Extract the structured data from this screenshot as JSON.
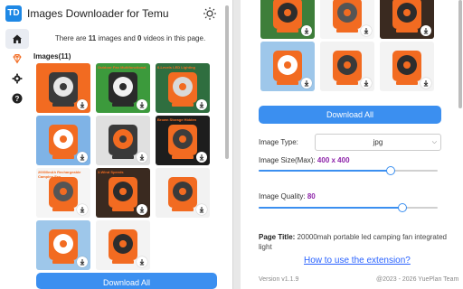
{
  "header": {
    "logo_text": "TD",
    "title": "Images Downloader for Temu"
  },
  "summary": {
    "prefix": "There are ",
    "images": "11",
    "mid": " images and ",
    "videos": "0",
    "suffix": " videos in this page."
  },
  "images_label": "Images(11)",
  "thumbnails": [
    {
      "caption": "",
      "palette": [
        "#f26b21",
        "#3a3a3a",
        "#e7e7e7"
      ]
    },
    {
      "caption": "Outdoor Fan Multifunctional",
      "palette": [
        "#3c9a3c",
        "#2a2a2a",
        "#f1f1f1"
      ]
    },
    {
      "caption": "6-Levels LED Lighting",
      "palette": [
        "#2f6e3f",
        "#f26b21",
        "#d9d9d9"
      ]
    },
    {
      "caption": "",
      "palette": [
        "#7fb3e6",
        "#f26b21",
        "#ffffff"
      ]
    },
    {
      "caption": "",
      "palette": [
        "#e0e0e0",
        "#3a3a3a",
        "#f26b21"
      ]
    },
    {
      "caption": "Brown Storage Hidden",
      "palette": [
        "#1d1d1d",
        "#f26b21",
        "#3d3d3d"
      ]
    },
    {
      "caption": "20000mAh Rechargeable Camping Fan",
      "palette": [
        "#f5f5f5",
        "#f26b21",
        "#555555"
      ]
    },
    {
      "caption": "3-Wind Speeds",
      "palette": [
        "#3a2a20",
        "#f26b21",
        "#2c2c2c"
      ]
    },
    {
      "caption": "",
      "palette": [
        "#f2f2f2",
        "#f26b21",
        "#3a3a3a"
      ]
    },
    {
      "caption": "",
      "palette": [
        "#9ec7ea",
        "#f26b21",
        "#ffffff"
      ]
    },
    {
      "caption": "",
      "palette": [
        "#f3f3f3",
        "#f26b21",
        "#2d2d2d"
      ]
    }
  ],
  "right_thumbnails": [
    {
      "caption": "",
      "palette": [
        "#3e7e3a",
        "#f26b21",
        "#2d2d2d"
      ]
    },
    {
      "caption": "20000mAh Rechargeable Camping Fan",
      "palette": [
        "#f5f5f5",
        "#f26b21",
        "#555555"
      ]
    },
    {
      "caption": "3-Wind Speeds",
      "palette": [
        "#3a2a20",
        "#f26b21",
        "#2c2c2c"
      ]
    },
    {
      "caption": "",
      "palette": [
        "#9ec7ea",
        "#f26b21",
        "#ffffff"
      ]
    },
    {
      "caption": "",
      "palette": [
        "#f2f2f2",
        "#f26b21",
        "#3a3a3a"
      ]
    },
    {
      "caption": "",
      "palette": [
        "#f3f3f3",
        "#f26b21",
        "#2d2d2d"
      ]
    }
  ],
  "buttons": {
    "download_all": "Download All"
  },
  "settings": {
    "image_type_label": "Image Type:",
    "image_type_value": "jpg",
    "image_size_label": "Image Size(Max):",
    "image_size_value": "400 x 400",
    "image_size_level": 0.73,
    "image_quality_label": "Image Quality:",
    "image_quality_value": "80",
    "image_quality_level": 0.8
  },
  "page_title": {
    "label": "Page Title:",
    "value": "20000mah portable led camping fan integrated light"
  },
  "links": {
    "howto": "How to use the extension?"
  },
  "footer": {
    "version": "Version v1.1.9",
    "copyright": "@2023 - 2026 YuePlan Team"
  },
  "colors": {
    "accent": "#3b8ff0",
    "highlight": "#8e24aa",
    "brand_orange": "#f26b21"
  },
  "icons": {
    "nav": [
      "home-icon",
      "gem-icon",
      "gear-icon",
      "help-icon"
    ],
    "theme": "sun-icon"
  }
}
